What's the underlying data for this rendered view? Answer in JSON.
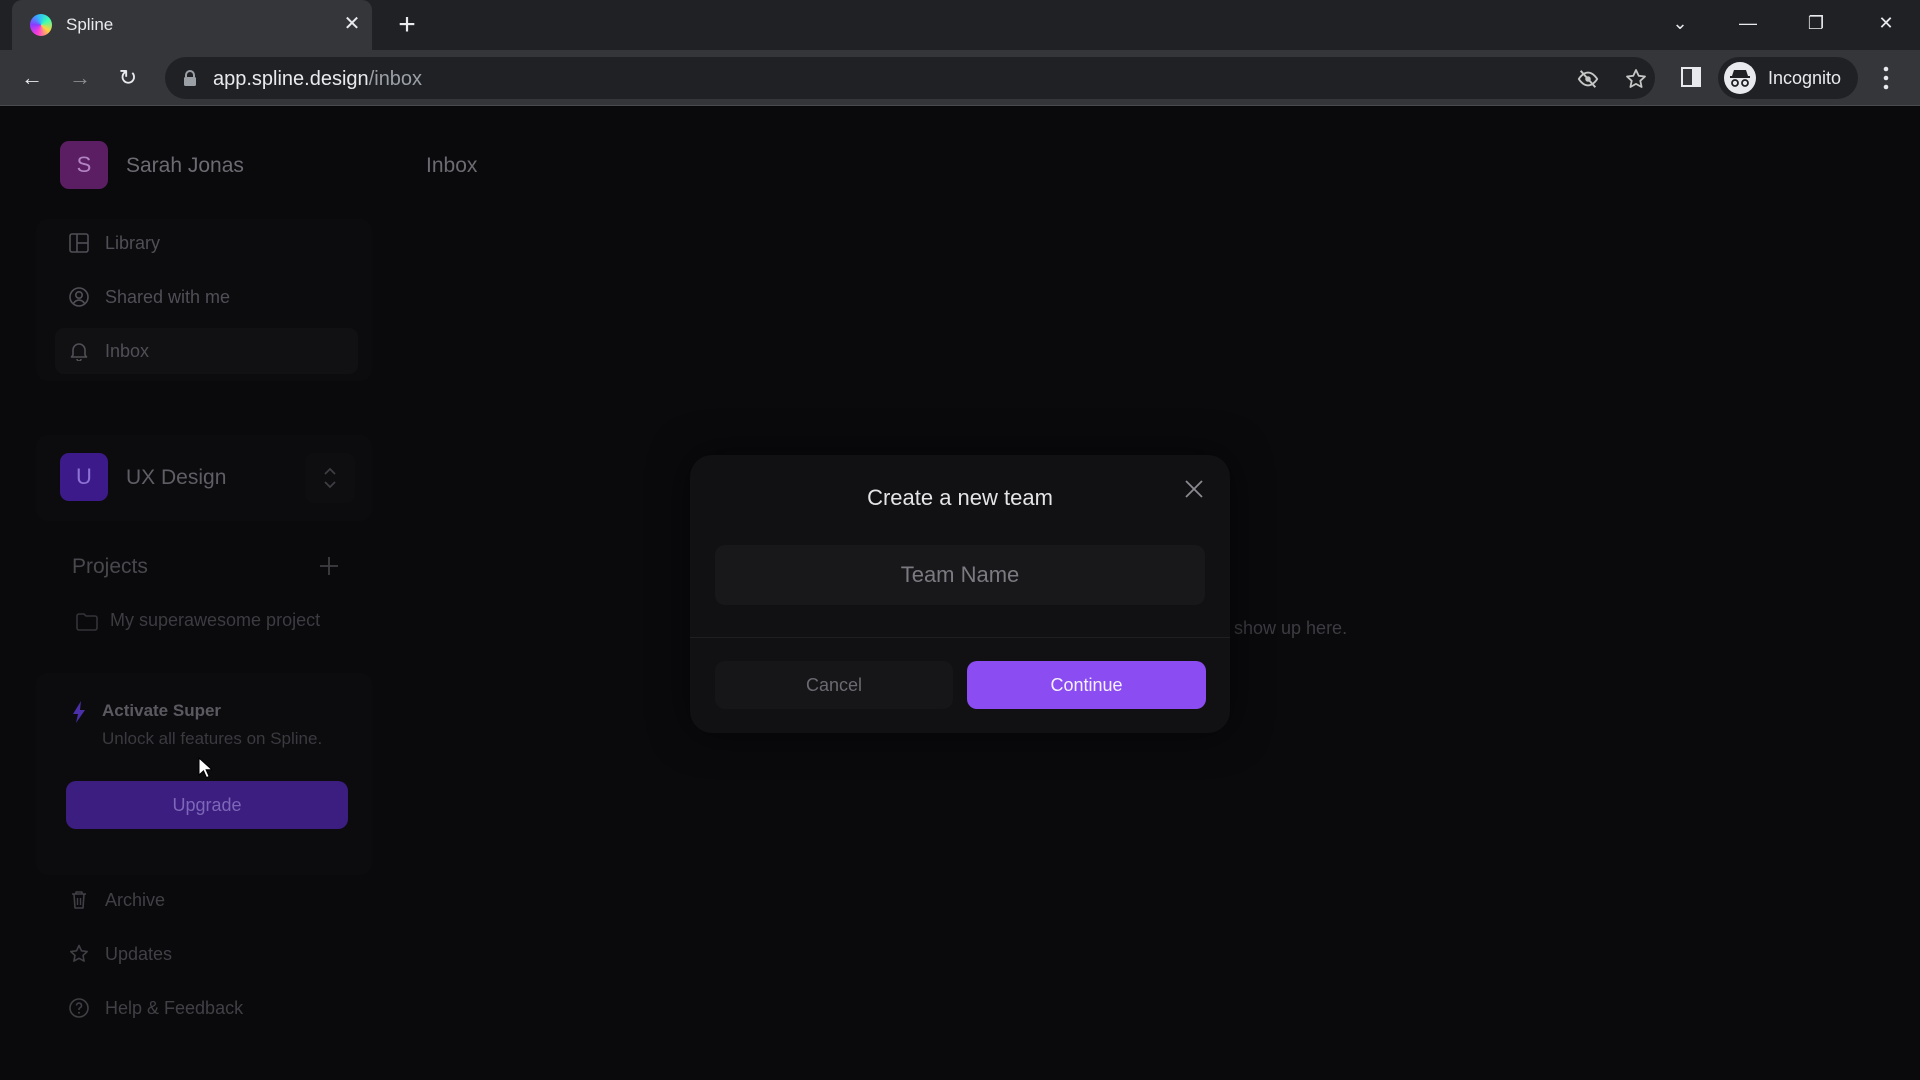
{
  "browser": {
    "tab_title": "Spline",
    "tab_close_glyph": "✕",
    "new_tab_glyph": "+",
    "url_host": "app.spline.design",
    "url_path": "/inbox",
    "incognito_label": "Incognito",
    "window_controls": {
      "tab_search": "⌄",
      "minimize": "—",
      "restore": "❐",
      "close": "✕"
    },
    "nav": {
      "back": "←",
      "forward": "→",
      "reload": "↻"
    }
  },
  "user": {
    "initial": "S",
    "name": "Sarah Jonas",
    "avatar_color": "#5c1e63"
  },
  "page": {
    "title": "Inbox",
    "empty_state_text_visible": "show up here."
  },
  "sidebar": {
    "nav_items": [
      {
        "label": "Library",
        "icon": "library-icon",
        "active": false
      },
      {
        "label": "Shared with me",
        "icon": "user-circle-icon",
        "active": false
      },
      {
        "label": "Inbox",
        "icon": "bell-icon",
        "active": true
      }
    ],
    "team": {
      "initial": "U",
      "name": "UX Design",
      "avatar_color": "#3d1a8a"
    },
    "projects": {
      "label": "Projects",
      "items": [
        {
          "label": "My superawesome project",
          "icon": "folder-icon"
        }
      ]
    },
    "promo": {
      "title": "Activate Super",
      "subtitle": "Unlock all features on Spline.",
      "button_label": "Upgrade"
    },
    "footer_items": [
      {
        "label": "Archive",
        "icon": "trash-icon"
      },
      {
        "label": "Updates",
        "icon": "star-icon"
      },
      {
        "label": "Help & Feedback",
        "icon": "help-circle-icon"
      }
    ]
  },
  "modal": {
    "title": "Create a new team",
    "input": {
      "value": "",
      "placeholder": "Team Name"
    },
    "cancel_label": "Cancel",
    "continue_label": "Continue",
    "accent_color": "#8b4cf2"
  }
}
